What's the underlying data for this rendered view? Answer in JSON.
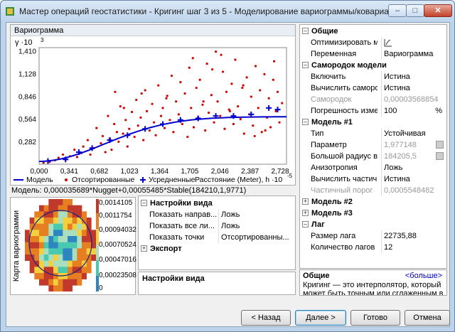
{
  "window": {
    "title": "Мастер операций геостатистики - Кригинг шаг 3 из 5 - Моделирование вариограммы/ковариации",
    "controls": {
      "minimize": "–",
      "maximize": "□",
      "close": "✕"
    }
  },
  "variogram": {
    "panel_title": "Вариограмма",
    "formula": "Модель: 0,000035689*Nugget+0,00055485*Stable(184210,1,9771)"
  },
  "chart_data": {
    "type": "scatter",
    "title": "",
    "ylabel": "γ ·10",
    "ylabel_exp": "3",
    "xlabel": "Расстояние (Meter), h ·10",
    "xlabel_exp": "-5",
    "xlim": [
      0,
      2.8
    ],
    "ylim": [
      0,
      1.45
    ],
    "x_ticks": [
      "0,000",
      "0,341",
      "0,682",
      "1,023",
      "1,364",
      "1,705",
      "2,046",
      "2,387",
      "2,728"
    ],
    "x_tick_values": [
      0,
      0.341,
      0.682,
      1.023,
      1.364,
      1.705,
      2.046,
      2.387,
      2.728
    ],
    "y_ticks": [
      "0,282",
      "0,564",
      "0,846",
      "1,128",
      "1,410"
    ],
    "y_tick_values": [
      0.282,
      0.564,
      0.846,
      1.128,
      1.41
    ],
    "legend": [
      {
        "label": "Модель",
        "color": "#0000cc",
        "marker": "line"
      },
      {
        "label": "Отсортированные",
        "color": "#cc0000",
        "marker": "dot"
      },
      {
        "label": "Усредненные",
        "color": "#0000cc",
        "marker": "plus"
      }
    ],
    "model": {
      "nugget": 0.0357,
      "sill": 0.5906,
      "range": 1.8421,
      "power": 1.9771
    },
    "averaged": {
      "name": "Усредненные",
      "x": [
        0.1,
        0.3,
        0.45,
        0.6,
        0.8,
        1.0,
        1.2,
        1.4,
        1.6,
        1.8,
        2.0,
        2.2,
        2.4,
        2.6,
        2.7
      ],
      "y": [
        0.04,
        0.06,
        0.15,
        0.2,
        0.3,
        0.36,
        0.44,
        0.5,
        0.55,
        0.57,
        0.6,
        0.6,
        0.62,
        0.7,
        0.68
      ]
    },
    "sorted": {
      "name": "Отсортированные",
      "x": [
        0.05,
        0.12,
        0.18,
        0.22,
        0.27,
        0.3,
        0.35,
        0.4,
        0.43,
        0.48,
        0.5,
        0.55,
        0.58,
        0.62,
        0.65,
        0.7,
        0.72,
        0.75,
        0.78,
        0.8,
        0.82,
        0.85,
        0.88,
        0.9,
        0.92,
        0.95,
        0.98,
        1.0,
        1.02,
        1.05,
        1.08,
        1.1,
        1.12,
        1.15,
        1.18,
        1.2,
        1.22,
        1.25,
        1.28,
        1.3,
        1.32,
        1.35,
        1.38,
        1.4,
        1.42,
        1.45,
        1.48,
        1.5,
        1.52,
        1.55,
        1.58,
        1.6,
        1.62,
        1.65,
        1.68,
        1.7,
        1.72,
        1.75,
        1.78,
        1.8,
        1.82,
        1.85,
        1.88,
        1.9,
        1.92,
        1.95,
        1.98,
        2.0,
        2.02,
        2.05,
        2.08,
        2.1,
        2.12,
        2.15,
        2.18,
        2.2,
        2.22,
        2.25,
        2.28,
        2.3,
        2.32,
        2.35,
        2.38,
        2.4,
        2.42,
        2.45,
        2.48,
        2.5,
        2.52,
        2.55,
        2.58,
        2.6,
        2.62,
        2.65,
        2.68,
        2.7,
        2.72,
        2.75,
        1.74,
        1.96,
        2.31,
        2.66,
        1.16,
        0.96,
        0.86,
        1.44,
        1.86,
        2.16,
        2.44,
        2.56,
        2.06
      ],
      "y": [
        0.02,
        0.03,
        0.05,
        0.08,
        0.12,
        0.06,
        0.1,
        0.18,
        0.09,
        0.14,
        0.22,
        0.3,
        0.12,
        0.2,
        0.45,
        0.26,
        0.35,
        0.15,
        0.6,
        0.32,
        0.18,
        0.5,
        0.4,
        0.28,
        0.72,
        0.38,
        0.55,
        0.22,
        0.44,
        0.65,
        0.34,
        0.8,
        0.48,
        0.58,
        0.3,
        0.92,
        0.66,
        0.42,
        0.75,
        0.52,
        0.36,
        0.98,
        0.6,
        0.7,
        0.45,
        0.85,
        0.55,
        1.1,
        0.4,
        0.78,
        0.62,
        1.02,
        0.5,
        0.88,
        0.34,
        1.2,
        0.7,
        0.46,
        0.95,
        0.58,
        1.05,
        0.74,
        0.42,
        1.25,
        0.64,
        0.86,
        0.52,
        1.4,
        0.78,
        0.6,
        1.15,
        0.44,
        0.9,
        0.68,
        1.0,
        0.5,
        1.3,
        0.72,
        0.56,
        0.95,
        0.38,
        1.08,
        0.62,
        0.84,
        0.48,
        1.22,
        0.7,
        0.92,
        0.4,
        1.12,
        0.58,
        0.82,
        0.46,
        1.05,
        0.66,
        0.9,
        0.52,
        0.76,
        1.32,
        1.18,
        0.98,
        1.28,
        0.88,
        0.7,
        0.9,
        0.82,
        0.78,
        0.66,
        0.35,
        0.42,
        1.36
      ]
    }
  },
  "map": {
    "ylabel": "Карта вариограмми",
    "legend_values": [
      "0,0014105",
      "0,0011754",
      "0,00094032",
      "0,00070524",
      "0,00047016",
      "0,00023508",
      "0"
    ]
  },
  "view_settings": {
    "category": "Настройки вида",
    "rows": [
      {
        "key": "Показать направ...",
        "value": "Ложь"
      },
      {
        "key": "Показать все ли...",
        "value": "Ложь"
      },
      {
        "key": "Показать точки",
        "value": "Отсортированны..."
      }
    ],
    "export_category": "Экспорт",
    "description_title": "Настройки вида"
  },
  "props": {
    "general": {
      "category": "Общие",
      "rows": [
        {
          "key": "Оптимизировать м...",
          "value": ""
        },
        {
          "key": "Переменная",
          "value": "Вариограмма"
        }
      ]
    },
    "nugget": {
      "category": "Самородок модели",
      "rows": [
        {
          "key": "Включить",
          "value": "Истина"
        },
        {
          "key": "Вычислить саморо...",
          "value": "Истина"
        },
        {
          "key": "Самородок",
          "value": "0,00003568854"
        },
        {
          "key": "Погрешность изме...",
          "value": "100",
          "unit": "%"
        }
      ]
    },
    "model1": {
      "category": "Модель #1",
      "rows": [
        {
          "key": "Тип",
          "value": "Устойчивая"
        },
        {
          "key": "Параметр",
          "value": "1,977148"
        },
        {
          "key": "Большой радиус вл...",
          "value": "184205,5"
        },
        {
          "key": "Анизотропия",
          "value": "Ложь"
        },
        {
          "key": "Вычислить частичн...",
          "value": "Истина"
        },
        {
          "key": "Частичный порог",
          "value": "0,0005548482"
        }
      ]
    },
    "model2": {
      "category": "Модель #2"
    },
    "model3": {
      "category": "Модель #3"
    },
    "lag": {
      "category": "Лаг",
      "rows": [
        {
          "key": "Размер лага",
          "value": "22735,88"
        },
        {
          "key": "Количество лагов",
          "value": "12"
        }
      ]
    }
  },
  "description": {
    "title": "Общие",
    "more": "<больше>",
    "text1": "Кригинг — это интерполятор, который",
    "text2": "может быть точным или сглаженным в з..."
  },
  "buttons": {
    "back": "< Назад",
    "next": "Далее >",
    "finish": "Готово",
    "cancel": "Отмена"
  }
}
